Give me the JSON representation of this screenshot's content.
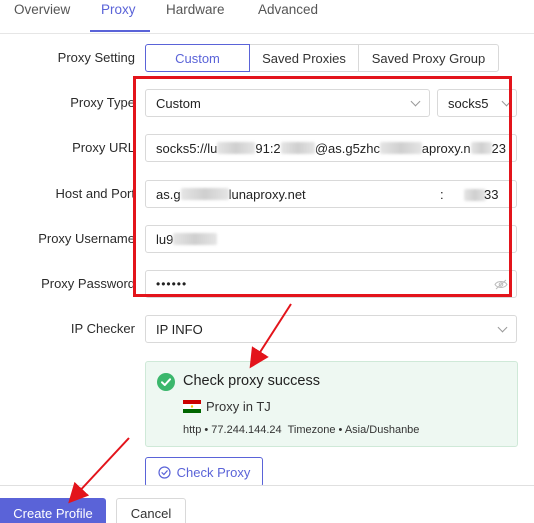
{
  "tabs": [
    "Overview",
    "Proxy",
    "Hardware",
    "Advanced"
  ],
  "labels": {
    "proxy_setting": "Proxy Setting",
    "proxy_type": "Proxy Type",
    "proxy_url": "Proxy URL",
    "host_port": "Host and Port",
    "username": "Proxy Username",
    "password": "Proxy Password",
    "ip_checker": "IP Checker"
  },
  "setting_options": [
    "Custom",
    "Saved Proxies",
    "Saved Proxy Group"
  ],
  "proxy_type": {
    "value": "Custom",
    "protocol": "socks5"
  },
  "proxy_url": {
    "prefix": "socks5://lu",
    "mid1": "91:2",
    "mid2": "@as.g5zhc",
    "mid3": "aproxy.n",
    "suffix": "23"
  },
  "host": {
    "prefix": "as.g",
    "suffix": "lunaproxy.net",
    "sep": ":",
    "port_suffix": "33"
  },
  "username": {
    "prefix": "lu9"
  },
  "password": "••••••",
  "ip_checker": "IP INFO",
  "result": {
    "title": "Check proxy success",
    "location": "Proxy in TJ",
    "details": "http • 77.244.144.24  Timezone • Asia/Dushanbe"
  },
  "buttons": {
    "check_proxy": "Check Proxy",
    "create_profile": "Create Profile",
    "cancel": "Cancel"
  },
  "colors": {
    "accent": "#5a63d8",
    "annotation_red": "#e3141b",
    "success_green": "#3bb76c"
  }
}
